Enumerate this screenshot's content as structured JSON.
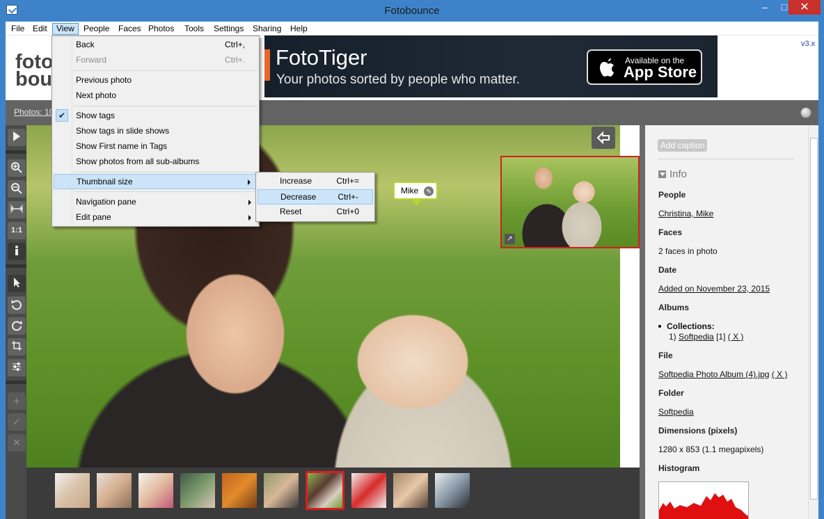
{
  "window": {
    "title": "Fotobounce",
    "min": "–",
    "max": "□",
    "close": "✕"
  },
  "menubar": [
    "File",
    "Edit",
    "View",
    "People",
    "Faces",
    "Photos",
    "Tools",
    "Settings",
    "Sharing",
    "Help"
  ],
  "banner": {
    "logo": "foto\nbounce",
    "ad_title": "FotoTiger",
    "ad_subtitle": "Your photos sorted by people who matter.",
    "store_line1": "Available on the",
    "store_line2": "App Store",
    "version": "v3.x"
  },
  "statusbar": {
    "photos_link": "Photos: 10"
  },
  "view_menu": {
    "items": [
      {
        "label": "Back",
        "shortcut": "Ctrl+,"
      },
      {
        "label": "Forward",
        "shortcut": "Ctrl+.",
        "disabled": true
      },
      {
        "label": "Previous photo"
      },
      {
        "label": "Next photo"
      },
      {
        "label": "Show tags",
        "checked": true
      },
      {
        "label": "Show tags in slide shows"
      },
      {
        "label": "Show First name in Tags"
      },
      {
        "label": "Show photos from all sub-albums"
      },
      {
        "label": "Thumbnail size",
        "submenu": true,
        "highlighted": true
      },
      {
        "label": "Navigation pane",
        "submenu": true
      },
      {
        "label": "Edit pane",
        "submenu": true
      }
    ]
  },
  "thumbnail_submenu": {
    "items": [
      {
        "label": "Increase",
        "shortcut": "Ctrl+="
      },
      {
        "label": "Decrease",
        "shortcut": "Ctrl+-",
        "highlighted": true
      },
      {
        "label": "Reset",
        "shortcut": "Ctrl+0"
      }
    ]
  },
  "photo": {
    "face_tag": "Mike"
  },
  "info_panel": {
    "add_caption": "Add caption",
    "section": "Info",
    "people_label": "People",
    "people_value": "Christina, Mike",
    "faces_label": "Faces",
    "faces_value": "2 faces in photo",
    "date_label": "Date",
    "date_value": "Added on November 23, 2015",
    "albums_label": "Albums",
    "collections_label": "Collections:",
    "collections_index": "1)",
    "collections_name": "Softpedia",
    "collections_count": "[1]",
    "collections_remove": "( X )",
    "file_label": "File",
    "file_value": "Softpedia Photo Album (4).jpg",
    "file_remove": "( X )",
    "folder_label": "Folder",
    "folder_value": "Softpedia",
    "dimensions_label": "Dimensions (pixels)",
    "dimensions_value": "1280 x 853 (1.1 megapixels)",
    "histogram_label": "Histogram"
  },
  "filmstrip": {
    "selected_index": 6,
    "count": 10
  },
  "colors": {
    "accent": "#3e83c9",
    "selection_red": "#d52020",
    "tag_green": "#b9d532"
  }
}
